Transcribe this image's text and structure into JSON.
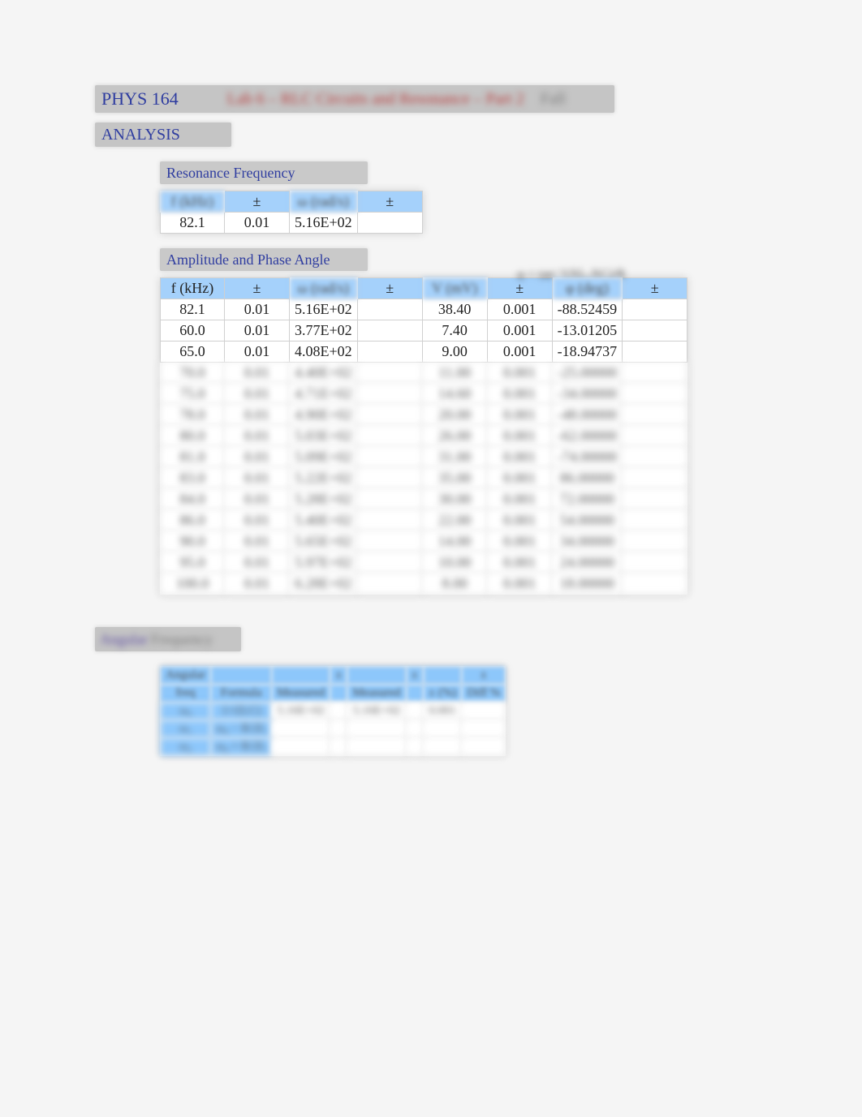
{
  "header": {
    "course": "PHYS 164",
    "red_text": "Lab 6 – RLC Circuits and Resonance – Part 2",
    "grey_text": "Fall"
  },
  "analysis_label": "ANALYSIS",
  "resonance": {
    "title": "Resonance Frequency",
    "headers": [
      "f (kHz)",
      "±",
      "ω (rad/s)",
      "±"
    ],
    "row": [
      "82.1",
      "0.01",
      "5.16E+02",
      ""
    ]
  },
  "amplitude": {
    "title": "Amplitude and Phase Angle",
    "side_note": "φ = tan⁻¹(XL-XC)/R",
    "headers": [
      "f (kHz)",
      "±",
      "ω (rad/s)",
      "±",
      "V (mV)",
      "±",
      "φ (deg)",
      "±"
    ],
    "rows": [
      [
        "82.1",
        "0.01",
        "5.16E+02",
        "",
        "38.40",
        "0.001",
        "-88.52459",
        ""
      ],
      [
        "60.0",
        "0.01",
        "3.77E+02",
        "",
        "7.40",
        "0.001",
        "-13.01205",
        ""
      ],
      [
        "65.0",
        "0.01",
        "4.08E+02",
        "",
        "9.00",
        "0.001",
        "-18.94737",
        ""
      ]
    ],
    "blur_rows": [
      [
        "70.0",
        "0.01",
        "4.40E+02",
        "",
        "11.00",
        "0.001",
        "-25.00000",
        ""
      ],
      [
        "75.0",
        "0.01",
        "4.71E+02",
        "",
        "14.60",
        "0.001",
        "-34.00000",
        ""
      ],
      [
        "78.0",
        "0.01",
        "4.90E+02",
        "",
        "20.00",
        "0.001",
        "-48.00000",
        ""
      ],
      [
        "80.0",
        "0.01",
        "5.03E+02",
        "",
        "26.00",
        "0.001",
        "-62.00000",
        ""
      ],
      [
        "81.0",
        "0.01",
        "5.09E+02",
        "",
        "31.00",
        "0.001",
        "-74.00000",
        ""
      ],
      [
        "83.0",
        "0.01",
        "5.22E+02",
        "",
        "35.00",
        "0.001",
        "86.00000",
        ""
      ],
      [
        "84.0",
        "0.01",
        "5.28E+02",
        "",
        "30.00",
        "0.001",
        "72.00000",
        ""
      ],
      [
        "86.0",
        "0.01",
        "5.40E+02",
        "",
        "22.00",
        "0.001",
        "54.00000",
        ""
      ],
      [
        "90.0",
        "0.01",
        "5.65E+02",
        "",
        "14.00",
        "0.001",
        "34.00000",
        ""
      ],
      [
        "95.0",
        "0.01",
        "5.97E+02",
        "",
        "10.00",
        "0.001",
        "24.00000",
        ""
      ],
      [
        "100.0",
        "0.01",
        "6.28E+02",
        "",
        "8.00",
        "0.001",
        "18.00000",
        ""
      ]
    ]
  },
  "section2": {
    "purple": "Angular",
    "grey": "Frequency"
  },
  "angular": {
    "headers_r1": [
      "Angular",
      "",
      "",
      "±",
      "",
      "±",
      "",
      "±"
    ],
    "headers_r2": [
      "freq",
      "Formula",
      "Measured",
      "",
      "Measured",
      "",
      "± (%)",
      "Diff %"
    ],
    "rows": [
      [
        "ω₀",
        "1/√(LC)",
        "5.16E+02",
        "",
        "5.16E+02",
        "",
        "0.001",
        ""
      ],
      [
        "ω₁",
        "ω₀ − R/2L",
        "",
        "",
        "",
        "",
        "",
        ""
      ],
      [
        "ω₂",
        "ω₀ + R/2L",
        "",
        "",
        "",
        "",
        "",
        ""
      ]
    ]
  }
}
